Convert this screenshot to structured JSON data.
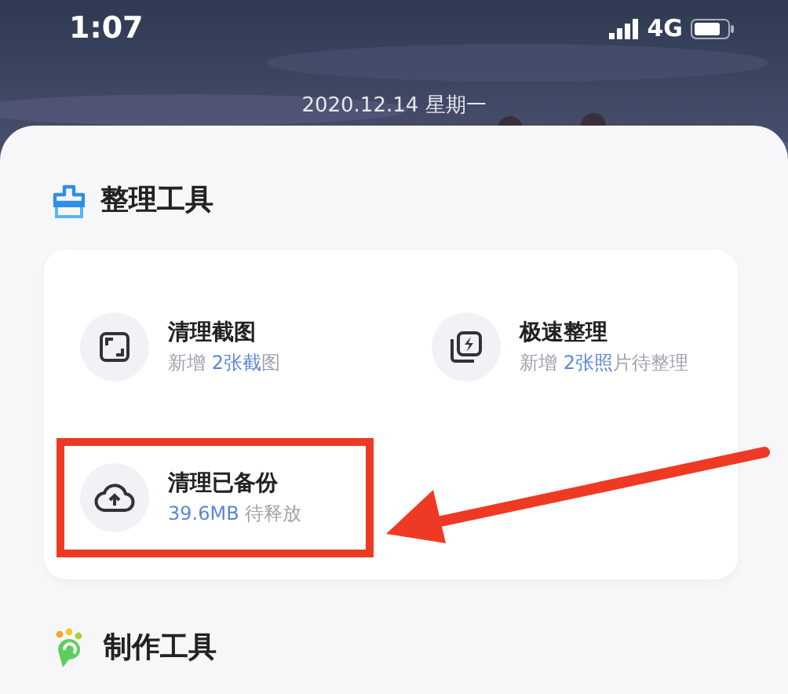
{
  "status_bar": {
    "time": "1:07",
    "network": "4G"
  },
  "lock_date": "2020.12.14  星期一",
  "sections": [
    {
      "title": "整理工具",
      "items": [
        {
          "title": "清理截图",
          "highlighted": false,
          "subtitle": [
            {
              "text": "新增 ",
              "highlight": false
            },
            {
              "text": "2张截",
              "highlight": true
            },
            {
              "text": "图",
              "highlight": false
            }
          ]
        },
        {
          "title": "极速整理",
          "highlighted": false,
          "subtitle": [
            {
              "text": "新增 ",
              "highlight": false
            },
            {
              "text": "2张照",
              "highlight": true
            },
            {
              "text": "片待整理",
              "highlight": false
            }
          ]
        },
        {
          "title": "清理已备份",
          "highlighted": true,
          "subtitle": [
            {
              "text": "39.6MB ",
              "highlight": true
            },
            {
              "text": "待释放",
              "highlight": false
            }
          ]
        }
      ]
    },
    {
      "title": "制作工具"
    }
  ]
}
